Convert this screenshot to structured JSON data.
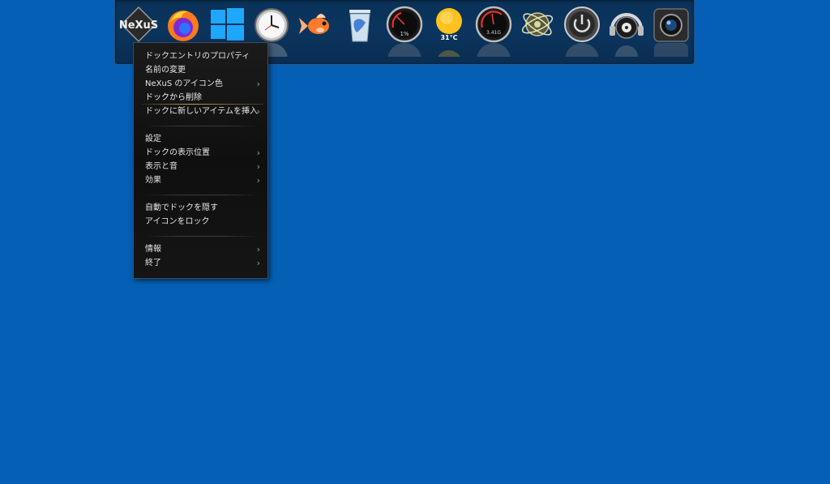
{
  "dock": {
    "items": [
      {
        "name": "nexus-logo-icon",
        "label": "NeXuS"
      },
      {
        "name": "firefox-icon"
      },
      {
        "name": "windows-icon"
      },
      {
        "name": "clock-icon"
      },
      {
        "name": "goldfish-icon"
      },
      {
        "name": "recycle-bin-icon"
      },
      {
        "name": "cpu-meter-icon",
        "label": "1%"
      },
      {
        "name": "weather-icon",
        "label": "31°C"
      },
      {
        "name": "memory-meter-icon",
        "label": "3.41G"
      },
      {
        "name": "network-globe-icon"
      },
      {
        "name": "power-icon"
      },
      {
        "name": "audio-headphones-icon"
      },
      {
        "name": "camera-icon"
      }
    ],
    "colors": {
      "background": "#0b355f",
      "desktop": "#0560b5"
    }
  },
  "menu": {
    "items": [
      {
        "label": "ドックエントリのプロパティ",
        "submenu": false
      },
      {
        "label": "名前の変更",
        "submenu": false
      },
      {
        "label": "NeXuS のアイコン色",
        "submenu": true
      },
      {
        "label": "ドックから削除",
        "submenu": false,
        "highlighted": true
      },
      {
        "label": "ドックに新しいアイテムを挿入",
        "submenu": true
      },
      {
        "label": "設定",
        "submenu": false
      },
      {
        "label": "ドックの表示位置",
        "submenu": true
      },
      {
        "label": "表示と音",
        "submenu": true
      },
      {
        "label": "効果",
        "submenu": true
      },
      {
        "label": "自動でドックを隠す",
        "submenu": false
      },
      {
        "label": "アイコンをロック",
        "submenu": false
      },
      {
        "label": "情報",
        "submenu": true
      },
      {
        "label": "終了",
        "submenu": true
      }
    ],
    "submenu_arrow": "›"
  }
}
